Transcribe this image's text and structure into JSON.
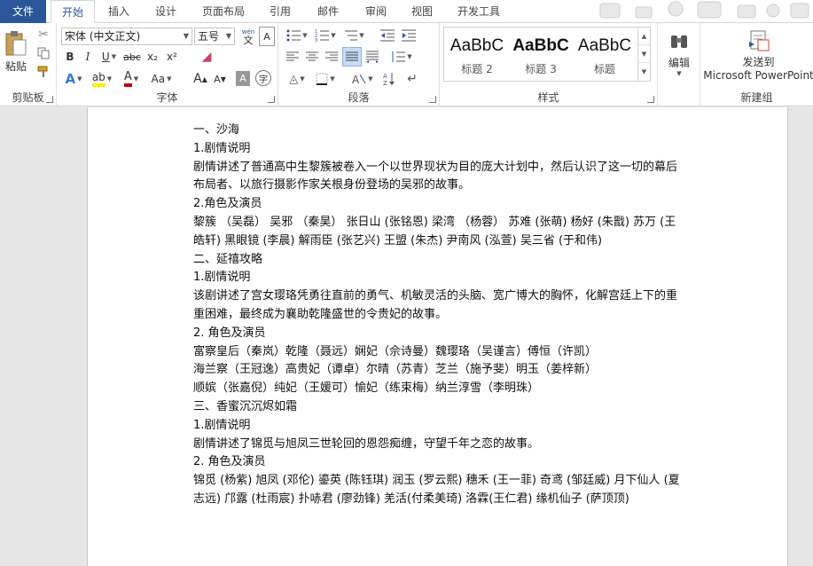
{
  "tabs": [
    "文件",
    "开始",
    "插入",
    "设计",
    "页面布局",
    "引用",
    "邮件",
    "审阅",
    "视图",
    "开发工具"
  ],
  "active_tab_index": 1,
  "ribbon": {
    "clipboard": {
      "paste_label": "粘贴",
      "group_label": "剪贴板"
    },
    "font": {
      "font_name": "宋体 (中文正文)",
      "font_size": "五号",
      "wen_icon": "wén",
      "group_label": "字体",
      "bold": "B",
      "italic": "I",
      "underline": "U",
      "strike": "abc",
      "subscript": "x₂",
      "superscript": "x²",
      "case": "Aa",
      "grow": "A",
      "shrink": "A",
      "char_shading": "A",
      "enclose": "字"
    },
    "paragraph": {
      "group_label": "段落"
    },
    "styles": {
      "items": [
        {
          "sample": "AaBbC",
          "name": "标题 2"
        },
        {
          "sample": "AaBbC",
          "name": "标题 3"
        },
        {
          "sample": "AaBbC",
          "name": "标题"
        }
      ],
      "group_label": "样式"
    },
    "editing": {
      "label": "编辑"
    },
    "newgroup": {
      "send_label_1": "发送到",
      "send_label_2": "Microsoft PowerPoint",
      "group_label": "新建组"
    }
  },
  "document": {
    "lines": [
      "一、沙海",
      "1.剧情说明",
      "剧情讲述了普通高中生黎簇被卷入一个以世界现状为目的庞大计划中，然后认识了这一切的幕后布局者、以旅行摄影作家关根身份登场的吴邪的故事。",
      "2.角色及演员",
      "黎簇 （吴磊） 吴邪 （秦昊） 张日山 (张铭恩) 梁湾 （杨蓉） 苏难 (张萌) 杨好 (朱戬) 苏万 (王皓轩) 黑眼镜 (李晨) 解雨臣 (张艺兴) 王盟 (朱杰) 尹南风 (泓萱) 吴三省 (于和伟)",
      "二、延禧攻略",
      "1.剧情说明",
      "该剧讲述了宫女璎珞凭勇往直前的勇气、机敏灵活的头脑、宽广博大的胸怀，化解宫廷上下的重重困难，最终成为襄助乾隆盛世的令贵妃的故事。",
      "2. 角色及演员",
      "富察皇后（秦岚）乾隆（聂远）娴妃（佘诗曼）魏璎珞（吴谨言）傅恒（许凯）",
      "海兰察（王冠逸）高贵妃（谭卓）尔晴（苏青）芝兰（施予斐）明玉（姜梓新）",
      "顺嫔（张嘉倪）纯妃（王媛可）愉妃（练束梅）纳兰淳雪（李明珠）",
      "三、香蜜沉沉烬如霜",
      "1.剧情说明",
      "剧情讲述了锦觅与旭凤三世轮回的恩怨痴缠，守望千年之恋的故事。",
      "2. 角色及演员",
      "锦觅 (杨紫) 旭凤 (邓伦) 鎏英 (陈钰琪) 润玉 (罗云熙) 穗禾 (王一菲) 奇鸢 (邹廷威) 月下仙人 (夏志远) 邝露 (杜雨宸) 扑哧君 (廖劲锋) 羌活(付柔美琦) 洛霖(王仁君) 缘机仙子 (萨顶顶)"
    ]
  }
}
